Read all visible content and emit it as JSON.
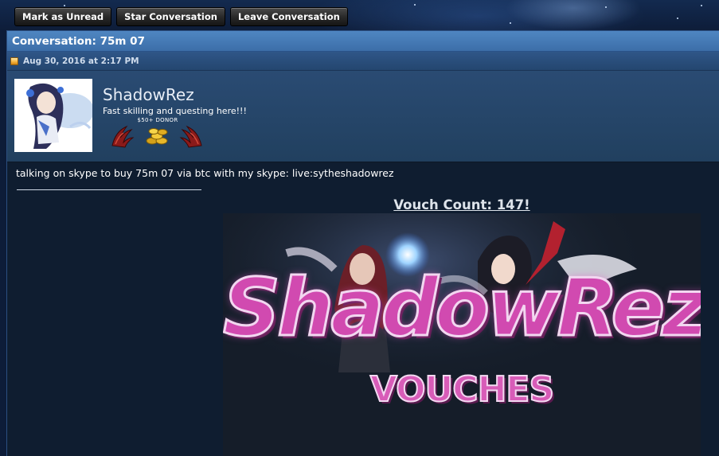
{
  "toolbar": {
    "mark_unread": "Mark as Unread",
    "star": "Star Conversation",
    "leave": "Leave Conversation"
  },
  "conversation": {
    "title": "Conversation: 75m 07",
    "date": "Aug 30, 2016 at 2:17 PM"
  },
  "user": {
    "name": "ShadowRez",
    "title": "Fast skilling and questing here!!!",
    "donor_label": "$50+  DONOR"
  },
  "post": {
    "message": "talking on skype to buy 75m 07 via btc with my skype: live:sytheshadowrez",
    "vouch": "Vouch Count: 147!",
    "banner_title": "ShadowRez",
    "banner_subtitle": "VOUCHES"
  },
  "colors": {
    "header_blue": "#3c6ea8",
    "panel_dark": "#0f1d30",
    "banner_pink": "#d14ab0"
  },
  "icons": [
    "document-icon",
    "claw-badge-icon",
    "gold-coins-icon"
  ]
}
